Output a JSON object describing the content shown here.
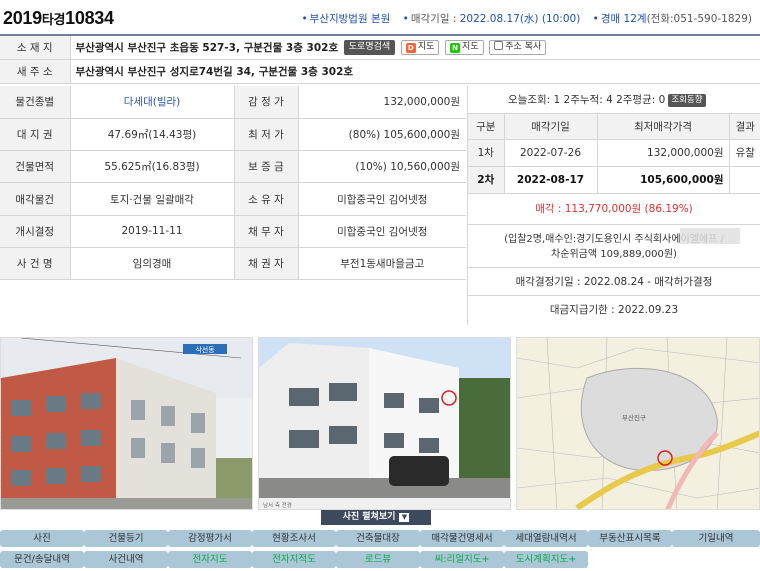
{
  "header": {
    "case_year": "2019",
    "case_type": "타경",
    "case_num": "10834",
    "court": "부산지방법원 본원",
    "sale_date_label": "매각기일 : ",
    "sale_date": "2022.08.17(水) (10:00)",
    "dept_prefix": "경매",
    "dept": "12계",
    "phone": "(전화:051-590-1829)"
  },
  "address": {
    "location_label": "소 재 지",
    "location": "부산광역시 부산진구 초읍동 527-3, 구분건물 3층 302호",
    "road_search_btn": "도로명검색",
    "daum_map_btn": "지도",
    "naver_map_btn": "지도",
    "copy_btn": "주소 복사",
    "new_addr_label": "새 주 소",
    "new_addr": "부산광역시 부산진구 성지로74번길 34, 구분건물 3층 302호"
  },
  "info": {
    "rows": [
      {
        "label": "물건종별",
        "value": "다세대(빌라)",
        "label2": "감 정 가",
        "value2": "132,000,000원"
      },
      {
        "label": "대 지 권",
        "value": "47.69㎡(14.43평)",
        "label2": "최 저 가",
        "value2": "(80%) 105,600,000원"
      },
      {
        "label": "건물면적",
        "value": "55.625㎡(16.83평)",
        "label2": "보 증 금",
        "value2": "(10%) 10,560,000원"
      },
      {
        "label": "매각물건",
        "value": "토지·건물 일괄매각",
        "label2": "소 유 자",
        "value2": "미합중국인 김어넷정"
      },
      {
        "label": "개시결정",
        "value": "2019-11-11",
        "label2": "채 무 자",
        "value2": "미합중국인 김어넷정"
      },
      {
        "label": "사 건 명",
        "value": "임의경매",
        "label2": "채 권 자",
        "value2": "부전1동새마을금고"
      }
    ]
  },
  "side": {
    "views": "오늘조회: 1  2주누적: 4  2주평균: 0",
    "views_btn": "조회동향",
    "headers": [
      "구분",
      "매각기일",
      "최저매각가격",
      "결과"
    ],
    "rounds": [
      {
        "no": "1차",
        "date": "2022-07-26",
        "price": "132,000,000원",
        "result": "유찰"
      },
      {
        "no": "2차",
        "date": "2022-08-17",
        "price": "105,600,000원",
        "result": ""
      }
    ],
    "sale_result": "매각 : 113,770,000원 (86.19%)",
    "bidders": "(입찰2명,매수인:경기도용인시 주식회사에이엘에프 /",
    "second": "차순위금액 109,889,000원)",
    "decision": "매각결정기일 : 2022.08.24 - 매각허가결정",
    "due": "대금지급기한 : 2022.09.23"
  },
  "photos": {
    "expand": "사진 펼쳐보기",
    "caption1": "삭선동",
    "caption2": "남서 측 전경",
    "caption3": "부산진구"
  },
  "tabs": [
    "사진",
    "건물등기",
    "감정평가서",
    "현황조사서",
    "건축물대장",
    "매각물건명세서",
    "세대열람내역서",
    "부동산표시목록",
    "기일내역",
    "문건/송달내역",
    "사건내역",
    "전자지도",
    "전자지적도",
    "로드뷰",
    "씨:리얼지도+",
    "도시계획지도+"
  ],
  "colors": {
    "accent": "#1e50b4",
    "sale": "#e03030",
    "tab_bg": "#aac6d7",
    "tab_green": "#0ba94a"
  }
}
